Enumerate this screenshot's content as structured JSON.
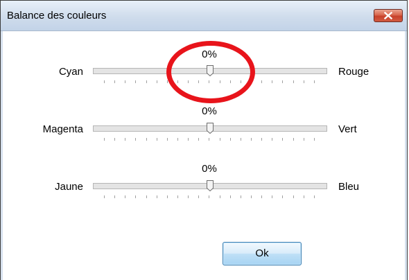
{
  "window": {
    "title": "Balance des couleurs"
  },
  "sliders": [
    {
      "left_label": "Cyan",
      "right_label": "Rouge",
      "value_text": "0%",
      "position": 0.5
    },
    {
      "left_label": "Magenta",
      "right_label": "Vert",
      "value_text": "0%",
      "position": 0.5
    },
    {
      "left_label": "Jaune",
      "right_label": "Bleu",
      "value_text": "0%",
      "position": 0.5
    }
  ],
  "buttons": {
    "ok_label": "Ok"
  },
  "icons": {
    "close": "close-icon",
    "slider_thumb": "slider-thumb-icon"
  },
  "colors": {
    "highlight": "#e8141b",
    "close_button": "#c7412b"
  }
}
